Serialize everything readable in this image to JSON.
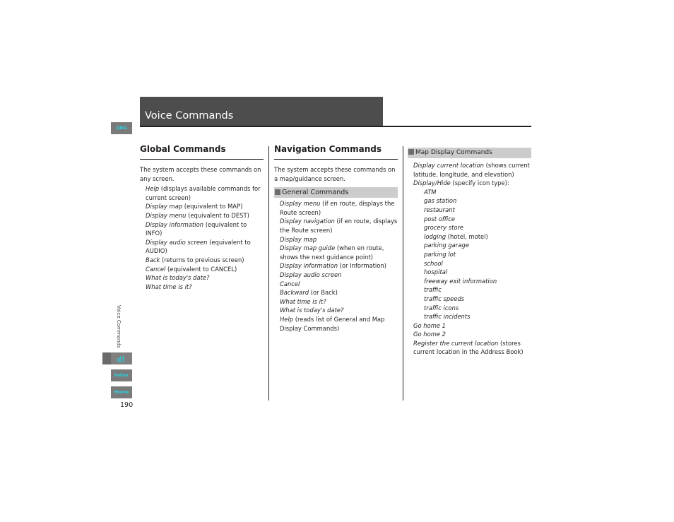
{
  "header": {
    "title": "Voice Commands"
  },
  "side_nav": {
    "qrg_label": "QRG",
    "vertical_label": "Voice Commands",
    "voice_icon": "voice-command-icon",
    "index_label": "Index",
    "home_label": "Home",
    "page_number": "190"
  },
  "global": {
    "heading": "Global Commands",
    "intro": "The system accepts these commands on any screen.",
    "items": [
      {
        "cmd": "Help",
        "desc": " (displays available commands for current screen)"
      },
      {
        "cmd": "Display map",
        "desc": " (equivalent to MAP)"
      },
      {
        "cmd": "Display menu",
        "desc": " (equivalent to DEST)"
      },
      {
        "cmd": "Display information",
        "desc": " (equivalent to INFO)"
      },
      {
        "cmd": "Display audio screen",
        "desc": " (equivalent to AUDIO)"
      },
      {
        "cmd": "Back",
        "desc": " (returns to previous screen)"
      },
      {
        "cmd": "Cancel",
        "desc": " (equivalent to CANCEL)"
      },
      {
        "cmd": "What is today's date?",
        "desc": ""
      },
      {
        "cmd": "What time is it?",
        "desc": ""
      }
    ]
  },
  "navigation": {
    "heading": "Navigation Commands",
    "intro": "The system accepts these commands on a map/guidance screen.",
    "general_heading": "General Commands",
    "items": [
      {
        "cmd": "Display menu",
        "desc": " (if en route, displays the Route screen)"
      },
      {
        "cmd": "Display navigation",
        "desc": " (if en route, displays the Route screen)"
      },
      {
        "cmd": "Display map",
        "desc": ""
      },
      {
        "cmd": "Display map guide",
        "desc": " (when en route, shows the next guidance point)"
      },
      {
        "cmd": "Display information",
        "desc": " (or Information)"
      },
      {
        "cmd": "Display audio screen",
        "desc": ""
      },
      {
        "cmd": "Cancel",
        "desc": ""
      },
      {
        "cmd": "Backward",
        "desc": " (or Back)"
      },
      {
        "cmd": "What time is it?",
        "desc": ""
      },
      {
        "cmd": "What is today's date?",
        "desc": ""
      },
      {
        "cmd": "Help",
        "desc": " (reads list of General and Map Display Commands)"
      }
    ]
  },
  "map_display": {
    "heading": "Map Display Commands",
    "items": [
      {
        "cmd": "Display current location",
        "desc": " (shows current latitude, longitude, and elevation)",
        "sub": false
      },
      {
        "cmd": "Display/Hide",
        "desc": " (specify icon type):",
        "sub": false
      },
      {
        "cmd": "ATM",
        "desc": "",
        "sub": true
      },
      {
        "cmd": "gas station",
        "desc": "",
        "sub": true
      },
      {
        "cmd": "restaurant",
        "desc": "",
        "sub": true
      },
      {
        "cmd": "post office",
        "desc": "",
        "sub": true
      },
      {
        "cmd": "grocery store",
        "desc": "",
        "sub": true
      },
      {
        "cmd": "lodging",
        "desc": " (hotel, motel)",
        "sub": true
      },
      {
        "cmd": "parking garage",
        "desc": "",
        "sub": true
      },
      {
        "cmd": "parking lot",
        "desc": "",
        "sub": true
      },
      {
        "cmd": "school",
        "desc": "",
        "sub": true
      },
      {
        "cmd": "hospital",
        "desc": "",
        "sub": true
      },
      {
        "cmd": "freeway exit information",
        "desc": "",
        "sub": true
      },
      {
        "cmd": "traffic",
        "desc": "",
        "sub": true
      },
      {
        "cmd": "traffic speeds",
        "desc": "",
        "sub": true
      },
      {
        "cmd": "traffic icons",
        "desc": "",
        "sub": true
      },
      {
        "cmd": "traffic incidents",
        "desc": "",
        "sub": true
      },
      {
        "cmd": "Go home 1",
        "desc": "",
        "sub": false
      },
      {
        "cmd": "Go home 2",
        "desc": "",
        "sub": false
      },
      {
        "cmd": "Register the current location",
        "desc": " (stores current location in the Address Book)",
        "sub": false
      }
    ]
  }
}
